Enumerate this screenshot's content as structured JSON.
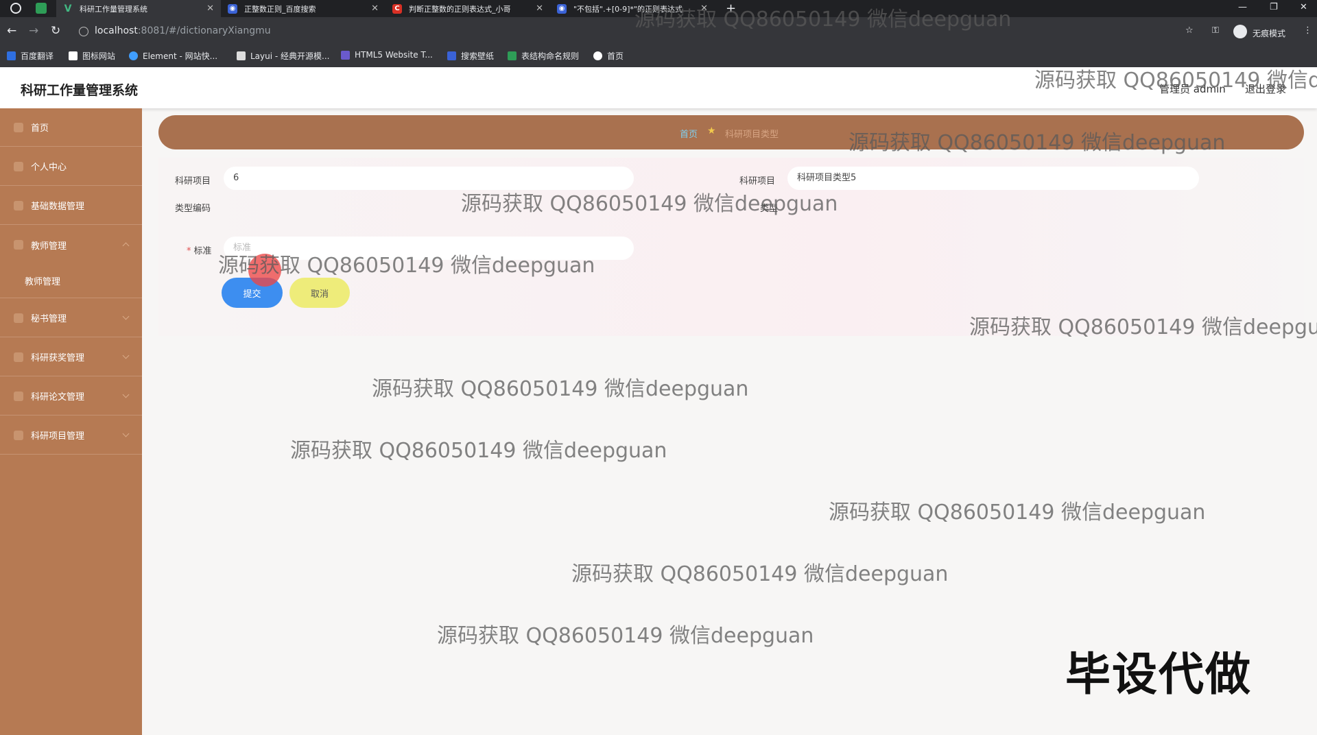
{
  "browser": {
    "tabs": [
      {
        "label": "科研工作量管理系统",
        "active": true,
        "favicon_color": "#4caf7a"
      },
      {
        "label": "正整数正则_百度搜索",
        "active": false,
        "favicon_color": "#3a62d6"
      },
      {
        "label": "判断正整数的正则表达式_小哥",
        "active": false,
        "favicon_color": "#d93025"
      },
      {
        "label": "\"不包括\".+[0-9]*\"的正则表达式",
        "active": false,
        "favicon_color": "#3a62d6"
      }
    ],
    "url_host": "localhost",
    "url_rest": ":8081/#/dictionaryXiangmu",
    "incognito_label": "无痕模式",
    "bookmarks": [
      {
        "label": "百度翻译",
        "color": "#2f6fe0"
      },
      {
        "label": "图标网站",
        "color": "#ffffff"
      },
      {
        "label": "Element - 网站快...",
        "color": "#409eff"
      },
      {
        "label": "Layui - 经典开源模...",
        "color": "#ffffff"
      },
      {
        "label": "HTML5 Website T...",
        "color": "#6a5acd"
      },
      {
        "label": "搜索壁纸",
        "color": "#3a62d6"
      },
      {
        "label": "表结构命名规则",
        "color": "#2e9d57"
      },
      {
        "label": "首页",
        "color": "#ffffff"
      }
    ]
  },
  "header": {
    "title": "科研工作量管理系统",
    "user_role": "管理员 admin",
    "logout": "退出登录"
  },
  "sidebar": {
    "items": [
      {
        "label": "首页"
      },
      {
        "label": "个人中心"
      },
      {
        "label": "基础数据管理"
      },
      {
        "label": "教师管理"
      },
      {
        "label": "秘书管理"
      },
      {
        "label": "科研获奖管理"
      },
      {
        "label": "科研论文管理"
      },
      {
        "label": "科研项目管理"
      }
    ],
    "submenu": "教师管理"
  },
  "breadcrumb": {
    "home": "首页",
    "current": "科研项目类型"
  },
  "form": {
    "field1_label": "科研项目",
    "field1_label2": "类型编码",
    "field1_value": "6",
    "field2_label": "科研项目",
    "field2_label2": "类型",
    "field2_value": "科研项目类型5",
    "field3_label": "标准",
    "field3_placeholder": "标准",
    "submit": "提交",
    "cancel": "取消"
  },
  "watermarks": [
    "源码获取 QQ86050149 微信deepguan",
    "源码获取 QQ86050149 微信deepguan",
    "源码获取 QQ86050149 微信deepguan",
    "源码获取 QQ86050149 微信deepguan",
    "源码获取 QQ86050149 微信deepguan",
    "源码获取 QQ86050149 微信deepguan",
    "源码获取 QQ86050149 微信deepguan",
    "源码获取 QQ86050149 微信deepguan",
    "源码获取 QQ86050149 微信deepguan",
    "源码获取 QQ86050149 微信deepguan",
    "源码获取 QQ86050149 微信deepguan"
  ],
  "side_banner": "毕设代做"
}
